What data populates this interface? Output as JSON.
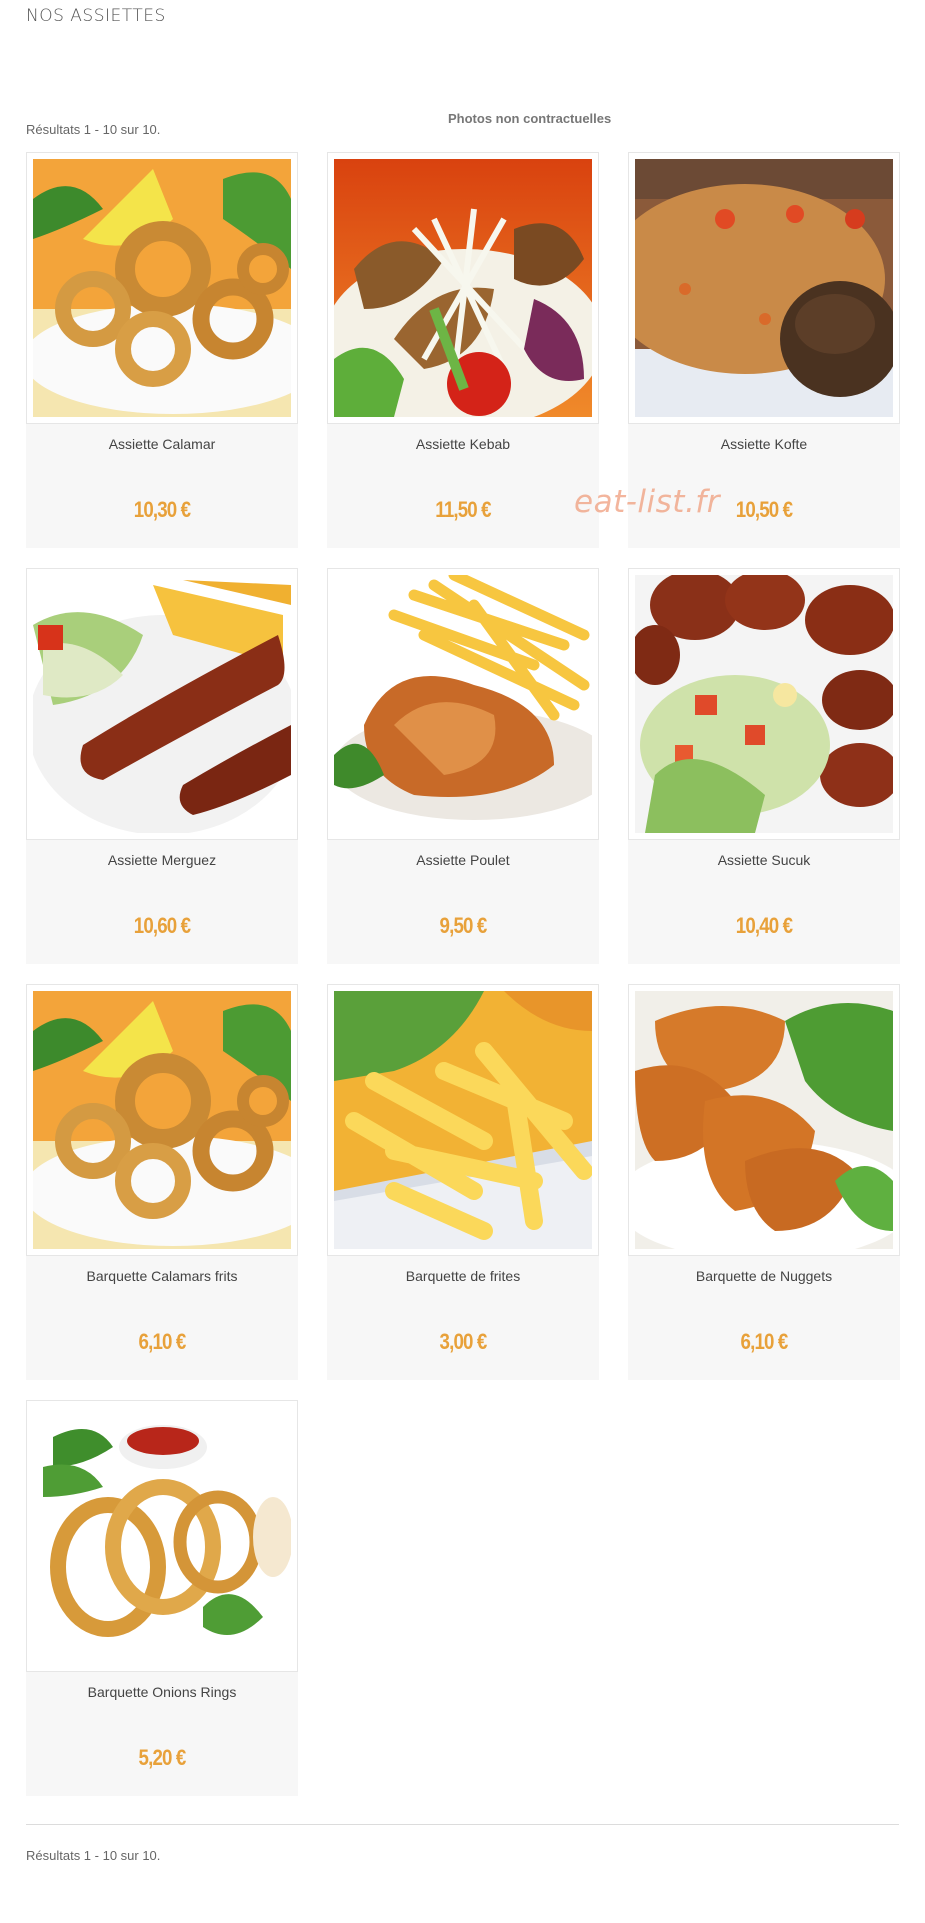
{
  "header": {
    "title": "NOS ASSIETTES",
    "results": "Résultats 1 - 10 sur 10.",
    "photos_note": "Photos non contractuelles"
  },
  "watermark": "eat-list.fr",
  "products": [
    {
      "name": "Assiette Calamar",
      "price": "10,30 €",
      "photo": "calamari-plate"
    },
    {
      "name": "Assiette Kebab",
      "price": "11,50 €",
      "photo": "kebab-salad"
    },
    {
      "name": "Assiette Kofte",
      "price": "10,50 €",
      "photo": "kofte-rice"
    },
    {
      "name": "Assiette Merguez",
      "price": "10,60 €",
      "photo": "merguez-fries"
    },
    {
      "name": "Assiette Poulet",
      "price": "9,50 €",
      "photo": "chicken-fries"
    },
    {
      "name": "Assiette Sucuk",
      "price": "10,40 €",
      "photo": "sucuk-salad"
    },
    {
      "name": "Barquette Calamars frits",
      "price": "6,10 €",
      "photo": "calamari-plate"
    },
    {
      "name": "Barquette de frites",
      "price": "3,00 €",
      "photo": "fries"
    },
    {
      "name": "Barquette de Nuggets",
      "price": "6,10 €",
      "photo": "nuggets"
    },
    {
      "name": "Barquette Onions Rings",
      "price": "5,20 €",
      "photo": "onion-rings"
    }
  ],
  "footer": {
    "results": "Résultats 1 - 10 sur 10."
  },
  "colors": {
    "price": "#e8a13a",
    "card_bg": "#f7f7f7",
    "watermark": "#f1a98c"
  }
}
